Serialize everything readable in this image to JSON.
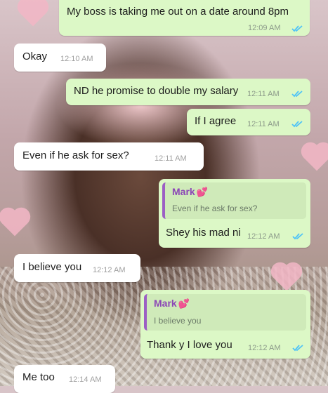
{
  "colors": {
    "outgoing_bubble": "#dcf8c6",
    "incoming_bubble": "#ffffff",
    "read_ticks": "#4fc3f7",
    "quote_accent": "#9c5fc4"
  },
  "messages": [
    {
      "direction": "outgoing",
      "text": "My boss is taking me out on a date around 8pm",
      "time": "12:09 AM",
      "status": "read"
    },
    {
      "direction": "incoming",
      "text": "Okay",
      "time": "12:10 AM"
    },
    {
      "direction": "outgoing",
      "text": "ND he promise to double my salary",
      "time": "12:11 AM",
      "status": "read"
    },
    {
      "direction": "outgoing",
      "text": "If I agree",
      "time": "12:11 AM",
      "status": "read"
    },
    {
      "direction": "incoming",
      "text": "Even if he ask for sex?",
      "time": "12:11 AM"
    },
    {
      "direction": "outgoing",
      "quote": {
        "author": "Mark",
        "author_icon": "two-hearts-icon",
        "text": "Even if he ask for sex?"
      },
      "text": "Shey his mad ni",
      "time": "12:12 AM",
      "status": "read"
    },
    {
      "direction": "incoming",
      "text": "I believe you",
      "time": "12:12 AM"
    },
    {
      "direction": "outgoing",
      "quote": {
        "author": "Mark",
        "author_icon": "two-hearts-icon",
        "text": "I believe you"
      },
      "text": "Thank y I love you",
      "time": "12:12 AM",
      "status": "read"
    },
    {
      "direction": "incoming",
      "text": "Me too",
      "time": "12:14 AM"
    }
  ]
}
